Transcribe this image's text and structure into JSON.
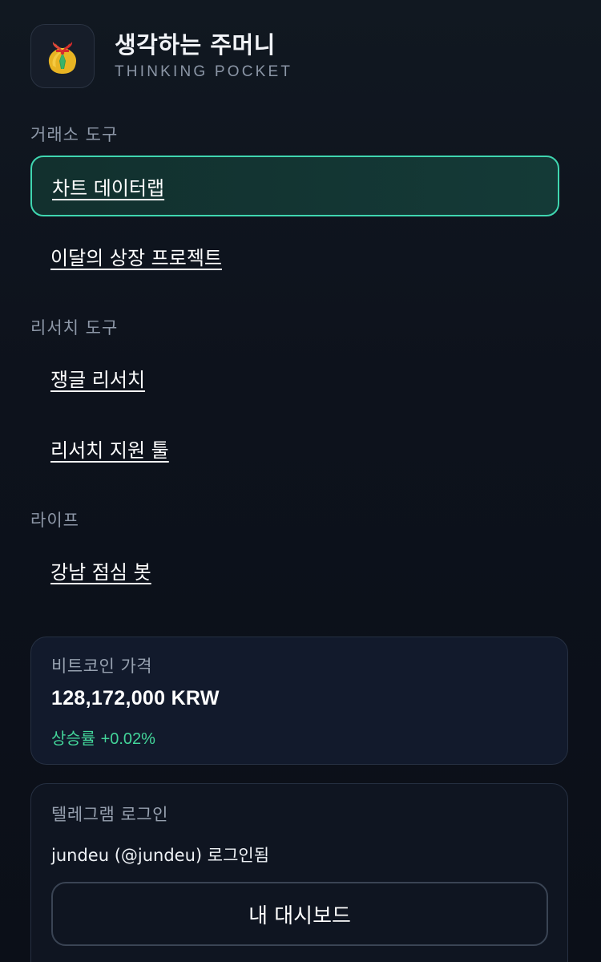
{
  "brand": {
    "title": "생각하는 주머니",
    "subtitle": "THINKING POCKET",
    "logo_icon": "money-bag-icon"
  },
  "sections": {
    "exchange": {
      "label": "거래소 도구",
      "items": [
        {
          "label": "차트 데이터랩",
          "active": true
        },
        {
          "label": "이달의 상장 프로젝트",
          "active": false
        }
      ]
    },
    "research": {
      "label": "리서치 도구",
      "items": [
        {
          "label": "쟁글 리서치"
        },
        {
          "label": "리서치 지원 툴"
        }
      ]
    },
    "life": {
      "label": "라이프",
      "items": [
        {
          "label": "강남 점심 봇"
        }
      ]
    }
  },
  "bitcoin": {
    "label": "비트코인 가격",
    "price": "128,172,000 KRW",
    "change_label": "상승률",
    "change_value": "+0.02%"
  },
  "telegram": {
    "label": "텔레그램 로그인",
    "status": "jundeu (@jundeu) 로그인됨",
    "dashboard_button": "내 대시보드"
  },
  "colors": {
    "accent": "#3fd6b0",
    "positive": "#43d59a",
    "background": "#0d121c"
  }
}
